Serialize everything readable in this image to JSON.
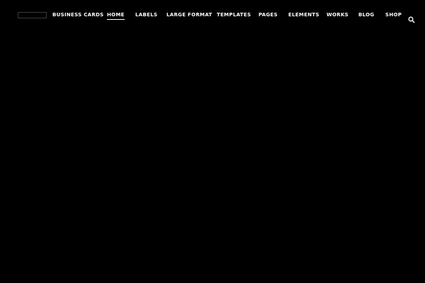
{
  "nav": {
    "items": [
      {
        "label": "BUSINESS CARDS"
      },
      {
        "label": "HOME"
      },
      {
        "label": "LABELS"
      },
      {
        "label": "LARGE FORMAT"
      },
      {
        "label": "TEMPLATES"
      },
      {
        "label": "PAGES"
      },
      {
        "label": "ELEMENTS"
      },
      {
        "label": "WORKS"
      },
      {
        "label": "BLOG"
      },
      {
        "label": "SHOP"
      }
    ],
    "active": "HOME"
  },
  "icons": {
    "search": "search-icon"
  },
  "colors": {
    "background": "#000000",
    "text": "#ffffff"
  }
}
